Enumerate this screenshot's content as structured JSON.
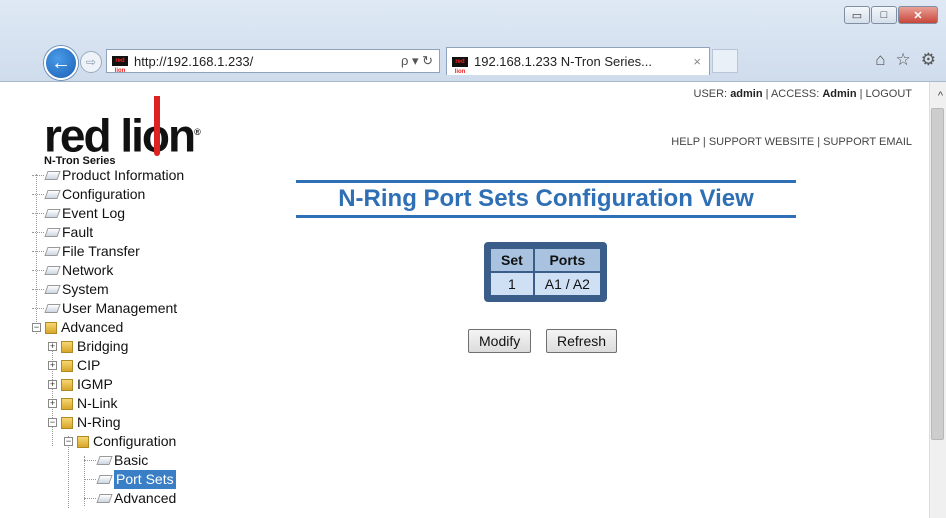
{
  "browser": {
    "url": "http://192.168.1.233/",
    "tab_title": "192.168.1.233 N-Tron Series...",
    "tab_close": "×",
    "addr_tools": "ρ ▾ ↻",
    "favicon_text": "red lion"
  },
  "header": {
    "logo_main": "red lion",
    "logo_reg": "®",
    "logo_sub": "N-Tron Series",
    "user_prefix": "USER:",
    "user_name": "admin",
    "access_prefix": "ACCESS:",
    "access_level": "Admin",
    "logout": "LOGOUT",
    "help": "HELP",
    "support_website": "SUPPORT WEBSITE",
    "support_email": "SUPPORT EMAIL",
    "sep": "|"
  },
  "tree": {
    "items": [
      {
        "label": "Product Information"
      },
      {
        "label": "Configuration"
      },
      {
        "label": "Event Log"
      },
      {
        "label": "Fault"
      },
      {
        "label": "File Transfer"
      },
      {
        "label": "Network"
      },
      {
        "label": "System"
      },
      {
        "label": "User Management"
      },
      {
        "label": "Advanced"
      },
      {
        "label": "Bridging"
      },
      {
        "label": "CIP"
      },
      {
        "label": "IGMP"
      },
      {
        "label": "N-Link"
      },
      {
        "label": "N-Ring"
      },
      {
        "label": "Configuration"
      },
      {
        "label": "Basic"
      },
      {
        "label": "Port Sets"
      },
      {
        "label": "Advanced"
      }
    ]
  },
  "main": {
    "title": "N-Ring Port Sets Configuration View",
    "table": {
      "headers": [
        "Set",
        "Ports"
      ],
      "rows": [
        [
          "1",
          "A1 / A2"
        ]
      ]
    },
    "modify_label": "Modify",
    "refresh_label": "Refresh"
  }
}
